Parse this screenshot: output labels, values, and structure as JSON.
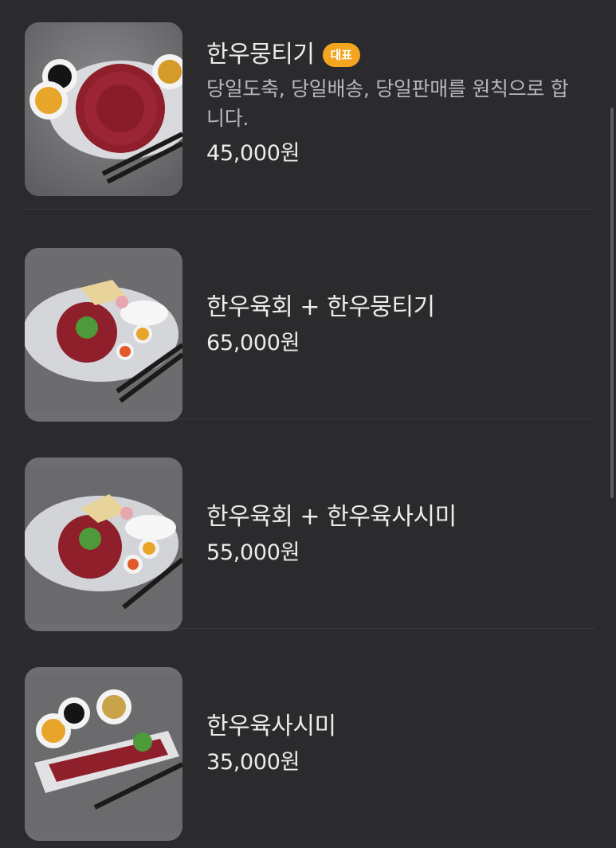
{
  "menu": {
    "items": [
      {
        "name": "한우뭉티기",
        "badge": "대표",
        "description": "당일도축, 당일배송, 당일판매를 원칙으로 합니다.",
        "price": "45,000원",
        "image_icon": "food-photo-beef-mungtigi"
      },
      {
        "name": "한우육회 + 한우뭉티기",
        "price": "65,000원",
        "image_icon": "food-photo-beef-tartare-platter"
      },
      {
        "name": "한우육회 + 한우육사시미",
        "price": "55,000원",
        "image_icon": "food-photo-beef-tartare-sashimi"
      },
      {
        "name": "한우육사시미",
        "price": "35,000원",
        "image_icon": "food-photo-beef-sashimi"
      }
    ]
  },
  "colors": {
    "background": "#2b2b2e",
    "badge": "#f4a51f",
    "text_primary": "#ececec",
    "text_secondary": "#b8b8bc"
  }
}
